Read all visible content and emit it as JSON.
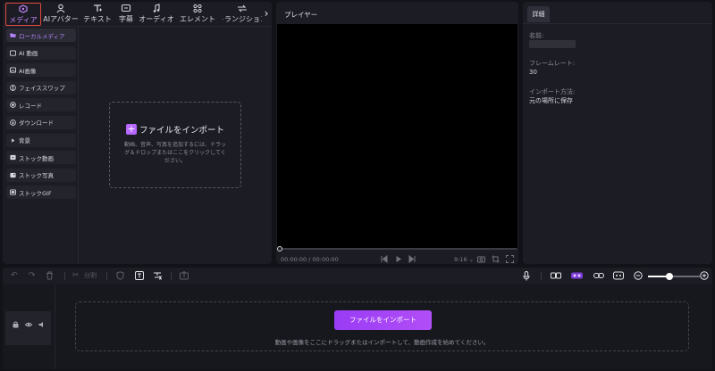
{
  "media_panel": {
    "tabs": [
      {
        "label": "メディア",
        "icon": "media-icon",
        "active": true
      },
      {
        "label": "AIアバター",
        "icon": "ai-avatar-icon"
      },
      {
        "label": "テキスト",
        "icon": "text-icon"
      },
      {
        "label": "字幕",
        "icon": "caption-icon"
      },
      {
        "label": "オーディオ",
        "icon": "audio-icon"
      },
      {
        "label": "エレメント",
        "icon": "element-icon"
      },
      {
        "label": "トランジション",
        "icon": "transition-icon"
      }
    ],
    "sidebar": [
      {
        "label": "ローカルメディア",
        "icon": "folder-icon",
        "active": true
      },
      {
        "label": "AI 動画",
        "icon": "ai-video-icon"
      },
      {
        "label": "AI画像",
        "icon": "ai-image-icon"
      },
      {
        "label": "フェイススワップ",
        "icon": "face-swap-icon"
      },
      {
        "label": "レコード",
        "icon": "record-icon"
      },
      {
        "label": "ダウンロード",
        "icon": "download-icon"
      },
      {
        "label": "背景",
        "icon": "background-icon"
      },
      {
        "label": "ストック動画",
        "icon": "stock-video-icon"
      },
      {
        "label": "ストック写真",
        "icon": "stock-photo-icon"
      },
      {
        "label": "ストックGIF",
        "icon": "stock-gif-icon"
      }
    ],
    "import": {
      "title": "ファイルをインポート",
      "description": "動画、音声、写真を追加するには、ドラッグ＆ドロップまたはここをクリックしてください。"
    }
  },
  "player": {
    "title": "プレイヤー",
    "time": "00:00:00 / 00:00:00",
    "aspect_ratio": "9:16",
    "progress": 0
  },
  "details": {
    "tab": "詳細",
    "name_label": "名前:",
    "framerate_label": "フレームレート:",
    "framerate_value": "30",
    "import_method_label": "インポート方法:",
    "import_method_value": "元の場所に保存"
  },
  "timeline": {
    "split_label": "分割",
    "zoom_level": 0.42,
    "import_button": "ファイルをインポート",
    "hint": "動画や画像をここにドラッグまたはインポートして、動画作成を始めてください。"
  },
  "colors": {
    "accent": "#b768ff",
    "active_tab_border": "#e0463d",
    "background": "#121318",
    "panel": "#1c1d24"
  }
}
